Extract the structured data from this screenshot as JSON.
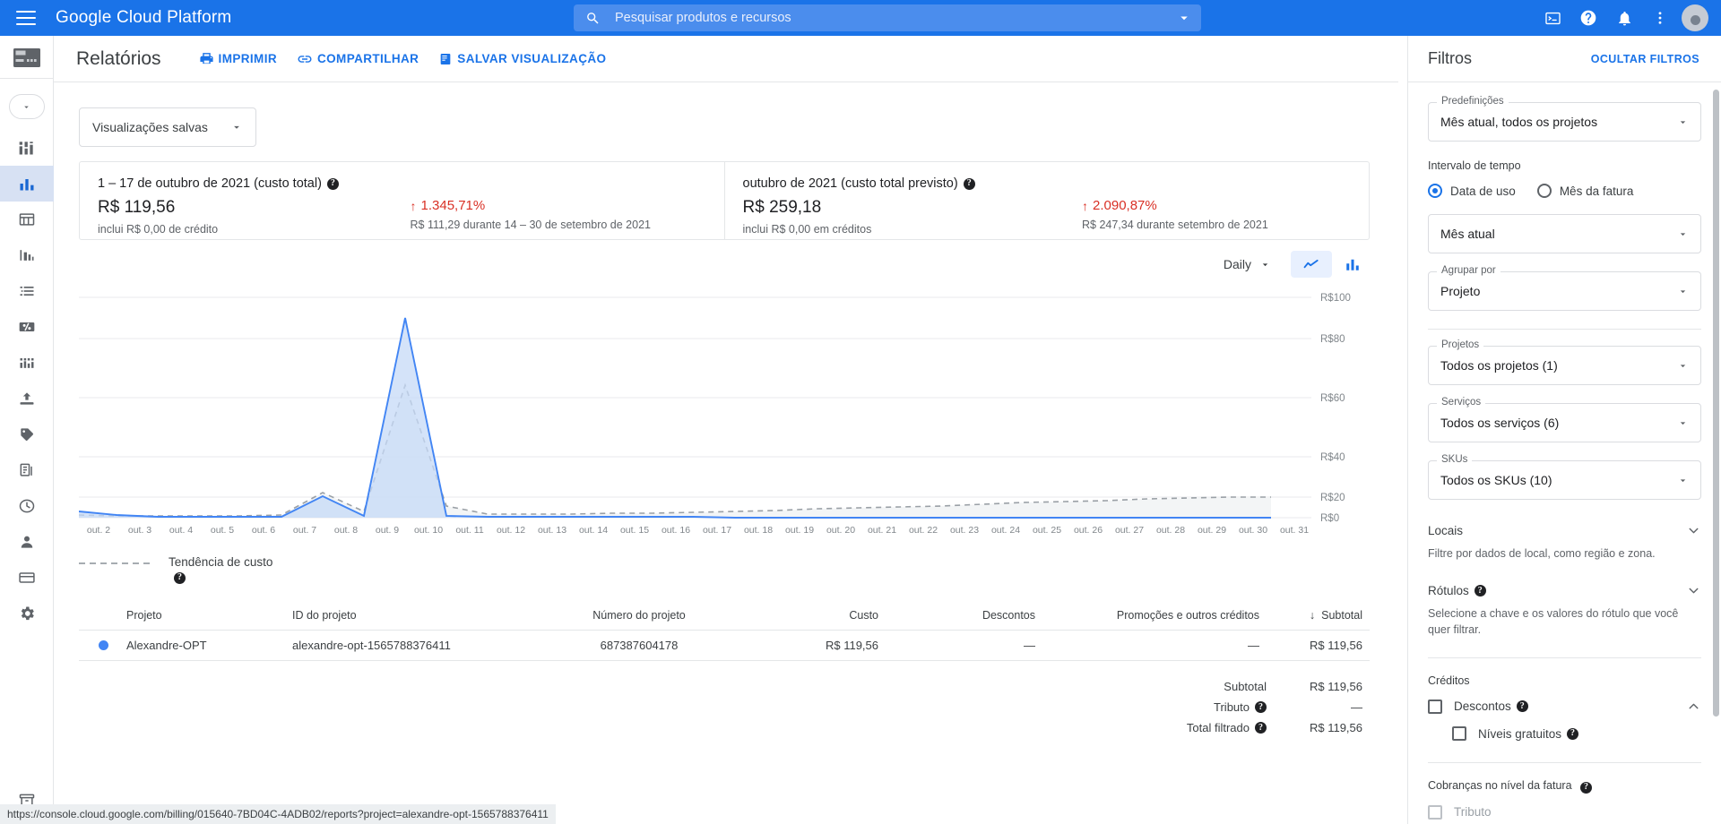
{
  "topbar": {
    "brand": "Google Cloud Platform",
    "menu_icon": "hamburger-icon",
    "search": {
      "placeholder": "Pesquisar produtos e recursos",
      "value": ""
    },
    "accent": "#1a73e8"
  },
  "page": {
    "title": "Relatórios",
    "actions": [
      {
        "label": "IMPRIMIR",
        "icon": "printer-icon"
      },
      {
        "label": "COMPARTILHAR",
        "icon": "link-icon"
      },
      {
        "label": "SALVAR VISUALIZAÇÃO",
        "icon": "save-view-icon"
      }
    ],
    "saved_views_label": "Visualizações salvas"
  },
  "cards": [
    {
      "title": "1 – 17 de outubro de 2021 (custo total)",
      "amount": "R$ 119,56",
      "sub": "inclui R$ 0,00 de crédito",
      "pct": "1.345,71%",
      "pct_arrow": "↑",
      "pct_color": "#d93025",
      "compare": "R$ 111,29 durante 14 – 30 de setembro de 2021"
    },
    {
      "title": "outubro de 2021 (custo total previsto)",
      "amount": "R$ 259,18",
      "sub": "inclui R$ 0,00 em créditos",
      "pct": "2.090,87%",
      "pct_arrow": "↑",
      "pct_color": "#d93025",
      "compare": "R$ 247,34 durante setembro de 2021"
    }
  ],
  "chart_toolbar": {
    "granularity": "Daily",
    "line_view_icon": "line-chart-icon",
    "bar_view_icon": "bar-chart-icon",
    "selected_view": "line"
  },
  "chart_data": {
    "type": "area",
    "title": "",
    "xlabel": "",
    "ylabel": "",
    "ylim": [
      0,
      100
    ],
    "yticks": [
      "R$0",
      "R$20",
      "R$40",
      "R$60",
      "R$80",
      "R$100"
    ],
    "ytick_values": [
      0,
      20,
      40,
      60,
      80,
      100
    ],
    "grid": true,
    "legend_position": "below",
    "categories": [
      "out. 2",
      "out. 3",
      "out. 4",
      "out. 5",
      "out. 6",
      "out. 7",
      "out. 8",
      "out. 9",
      "out. 10",
      "out. 11",
      "out. 12",
      "out. 13",
      "out. 14",
      "out. 15",
      "out. 16",
      "out. 17",
      "out. 18",
      "out. 19",
      "out. 20",
      "out. 21",
      "out. 22",
      "out. 23",
      "out. 24",
      "out. 25",
      "out. 26",
      "out. 27",
      "out. 28",
      "out. 29",
      "out. 30",
      "out. 31"
    ],
    "series": [
      {
        "name": "Alexandre-OPT",
        "color": "#4285f4",
        "style": "area",
        "values": [
          3.2,
          1.0,
          0.4,
          0.3,
          0.3,
          0.4,
          21.0,
          0.6,
          88.5,
          0.5,
          0.4,
          0.4,
          0.4,
          0.4,
          0.4,
          0.4,
          0,
          0,
          0,
          0,
          0,
          0,
          0,
          0,
          0,
          0,
          0,
          0,
          0,
          0
        ]
      },
      {
        "name": "Tendência de custo",
        "color": "#9aa0a6",
        "style": "dashed",
        "values": [
          1.0,
          0.8,
          0.7,
          0.7,
          0.8,
          1.0,
          9.0,
          2.0,
          56.0,
          3.0,
          1.5,
          1.4,
          1.5,
          1.6,
          1.7,
          2.0,
          2.2,
          2.6,
          3.0,
          3.2,
          3.6,
          3.9,
          4.4,
          5.0,
          5.4,
          5.8,
          6.4,
          6.8,
          7.0,
          7.2
        ]
      }
    ],
    "legend": [
      {
        "label": "Tendência de custo",
        "style": "dashed",
        "color": "#9aa0a6"
      }
    ]
  },
  "table": {
    "columns": [
      "Projeto",
      "ID do projeto",
      "Número do projeto",
      "Custo",
      "Descontos",
      "Promoções e outros créditos",
      "Subtotal"
    ],
    "sorted_column": "Subtotal",
    "sort_arrow": "↓",
    "rows": [
      {
        "color": "#4285f4",
        "project": "Alexandre-OPT",
        "project_id": "alexandre-opt-1565788376411",
        "project_number": "687387604178",
        "cost": "R$ 119,56",
        "discounts": "—",
        "promotions": "—",
        "subtotal": "R$ 119,56"
      }
    ],
    "totals": [
      {
        "label": "Subtotal",
        "help": false,
        "value": "R$ 119,56"
      },
      {
        "label": "Tributo",
        "help": true,
        "value": "—"
      },
      {
        "label": "Total filtrado",
        "help": true,
        "value": "R$ 119,56"
      }
    ]
  },
  "filters": {
    "title": "Filtros",
    "hide_label": "OCULTAR FILTROS",
    "preset": {
      "label": "Predefinições",
      "value": "Mês atual, todos os projetos"
    },
    "time_range": {
      "label": "Intervalo de tempo",
      "options": [
        {
          "label": "Data de uso",
          "selected": true
        },
        {
          "label": "Mês da fatura",
          "selected": false
        }
      ],
      "select_value": "Mês atual"
    },
    "group_by": {
      "label": "Agrupar por",
      "value": "Projeto"
    },
    "projects": {
      "label": "Projetos",
      "value": "Todos os projetos (1)"
    },
    "services": {
      "label": "Serviços",
      "value": "Todos os serviços (6)"
    },
    "skus": {
      "label": "SKUs",
      "value": "Todos os SKUs (10)"
    },
    "locations": {
      "title": "Locais",
      "desc": "Filtre por dados de local, como região e zona.",
      "expanded": false
    },
    "labels": {
      "title": "Rótulos",
      "desc": "Selecione a chave e os valores do rótulo que você quer filtrar.",
      "expanded": false
    },
    "credits": {
      "title": "Créditos",
      "discounts": {
        "label": "Descontos",
        "checked": false,
        "expanded": true
      },
      "free_tier": {
        "label": "Níveis gratuitos",
        "checked": false
      }
    },
    "invoice_charges": {
      "title": "Cobranças no nível da fatura",
      "tax": {
        "label": "Tributo",
        "checked": false,
        "disabled": true
      }
    }
  },
  "sidebar": {
    "items": [
      {
        "name": "sidebar-item-overview",
        "icon": "dashboard-icon",
        "active": false
      },
      {
        "name": "sidebar-item-reports",
        "icon": "bar-chart-icon",
        "active": true
      },
      {
        "name": "sidebar-item-cost-table",
        "icon": "table-icon",
        "active": false
      },
      {
        "name": "sidebar-item-cost-breakdown",
        "icon": "breakdown-icon",
        "active": false
      },
      {
        "name": "sidebar-item-pricing",
        "icon": "list-icon",
        "active": false
      },
      {
        "name": "sidebar-item-commitments",
        "icon": "percent-icon",
        "active": false
      },
      {
        "name": "sidebar-item-budgets-alerts",
        "icon": "columns-icon",
        "active": false
      },
      {
        "name": "sidebar-item-billing-export",
        "icon": "export-icon",
        "active": false
      },
      {
        "name": "sidebar-item-cost-optimization",
        "icon": "tag-icon",
        "active": false
      },
      {
        "name": "sidebar-item-documents",
        "icon": "documents-icon",
        "active": false
      },
      {
        "name": "sidebar-item-transactions",
        "icon": "clock-icon",
        "active": false
      },
      {
        "name": "sidebar-item-account-management",
        "icon": "person-icon",
        "active": false
      },
      {
        "name": "sidebar-item-payment-method",
        "icon": "credit-card-icon",
        "active": false
      },
      {
        "name": "sidebar-item-settings",
        "icon": "gear-icon",
        "active": false
      }
    ]
  },
  "status_bar": {
    "url": "https://console.cloud.google.com/billing/015640-7BD04C-4ADB02/reports?project=alexandre-opt-1565788376411"
  }
}
